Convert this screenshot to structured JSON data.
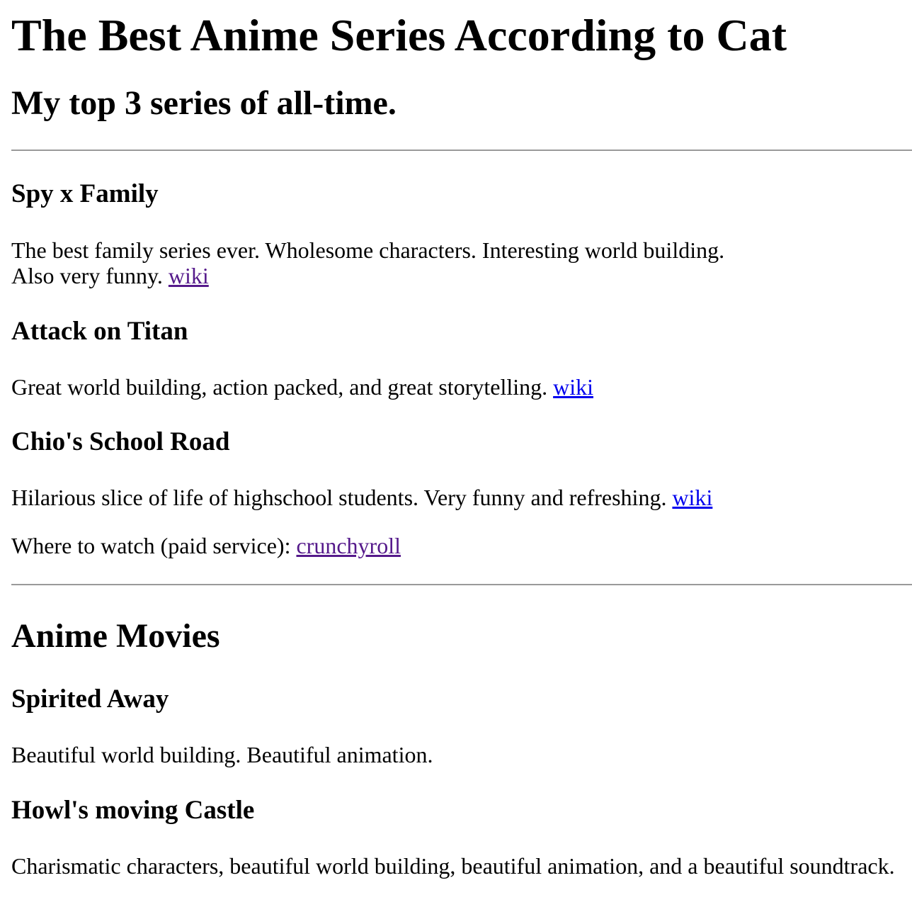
{
  "page": {
    "title": "The Best Anime Series According to Cat",
    "subtitle": "My top 3 series of all-time."
  },
  "series": [
    {
      "name": "Spy x Family",
      "description_line1": "The best family series ever. Wholesome characters. Interesting world building.",
      "description_line2": "Also very funny.",
      "link_text": "wiki"
    },
    {
      "name": "Attack on Titan",
      "description": "Great world building, action packed, and great storytelling.",
      "link_text": "wiki"
    },
    {
      "name": "Chio's School Road",
      "description": "Hilarious slice of life of highschool students. Very funny and refreshing.",
      "link_text": "wiki"
    }
  ],
  "watch": {
    "label": "Where to watch (paid service):",
    "link_text": "crunchyroll"
  },
  "movies": {
    "heading": "Anime Movies",
    "items": [
      {
        "name": "Spirited Away",
        "description": "Beautiful world building. Beautiful animation."
      },
      {
        "name": "Howl's moving Castle",
        "description": "Charismatic characters, beautiful world building, beautiful animation, and a beautiful soundtrack."
      }
    ]
  },
  "colors": {
    "link_visited": "#551a8b",
    "link_unvisited": "#0000ee",
    "divider": "#9a9a9a"
  }
}
